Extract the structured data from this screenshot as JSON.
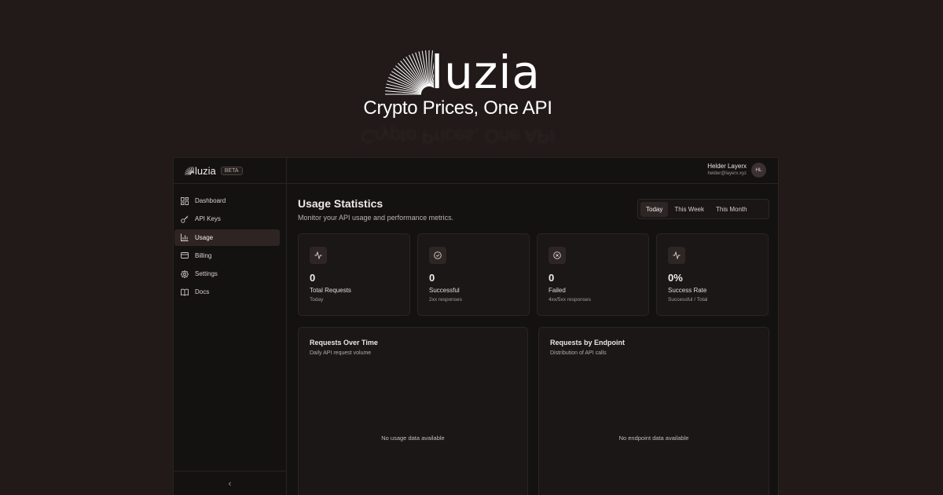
{
  "hero": {
    "brand": "luzia",
    "tagline": "Crypto Prices, One API"
  },
  "sidebar": {
    "brand": "luzia",
    "badge": "BETA",
    "items": [
      {
        "label": "Dashboard",
        "icon": "grid-icon",
        "active": false
      },
      {
        "label": "API Keys",
        "icon": "key-icon",
        "active": false
      },
      {
        "label": "Usage",
        "icon": "bar-chart-icon",
        "active": true
      },
      {
        "label": "Billing",
        "icon": "credit-card-icon",
        "active": false
      },
      {
        "label": "Settings",
        "icon": "gear-icon",
        "active": false
      },
      {
        "label": "Docs",
        "icon": "book-icon",
        "active": false
      }
    ],
    "collapse": "‹"
  },
  "topbar": {
    "user_name": "Helder Layerx",
    "user_email": "helder@layerx.xyz",
    "avatar_initials": "HL"
  },
  "page": {
    "title": "Usage Statistics",
    "subtitle": "Monitor your API usage and performance metrics.",
    "ranges": [
      "Today",
      "This Week",
      "This Month"
    ],
    "active_range": "Today"
  },
  "stats": [
    {
      "value": "0",
      "label": "Total Requests",
      "sub": "Today",
      "icon": "activity-icon"
    },
    {
      "value": "0",
      "label": "Successful",
      "sub": "2xx responses",
      "icon": "check-circle-icon"
    },
    {
      "value": "0",
      "label": "Failed",
      "sub": "4xx/5xx responses",
      "icon": "x-circle-icon"
    },
    {
      "value": "0%",
      "label": "Success Rate",
      "sub": "Successful / Total",
      "icon": "activity-icon"
    }
  ],
  "panels": [
    {
      "title": "Requests Over Time",
      "subtitle": "Daily API request volume",
      "empty": "No usage data available"
    },
    {
      "title": "Requests by Endpoint",
      "subtitle": "Distribution of API calls",
      "empty": "No endpoint data available"
    }
  ],
  "colors": {
    "background": "#211a19",
    "app_background": "#141111",
    "card": "#1b1716",
    "active_nav": "#2e2523",
    "border": "#2a2322"
  }
}
